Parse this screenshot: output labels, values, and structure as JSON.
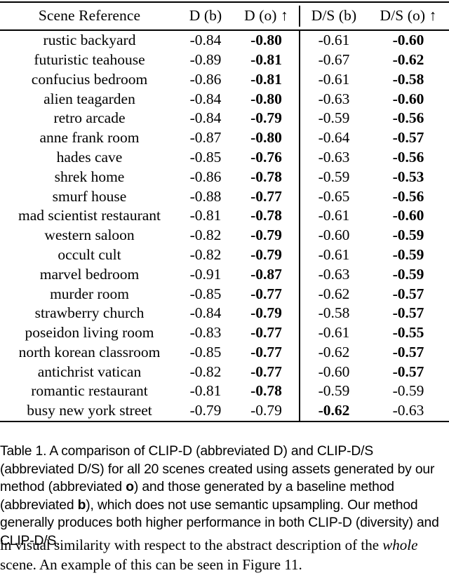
{
  "table": {
    "columns": [
      {
        "key": "scene",
        "label": "Scene Reference"
      },
      {
        "key": "d_b",
        "label": "D (b)"
      },
      {
        "key": "d_o",
        "label": "D (o) ↑"
      },
      {
        "key": "ds_b",
        "label": "D/S (b)"
      },
      {
        "key": "ds_o",
        "label": "D/S (o) ↑"
      }
    ],
    "rows": [
      {
        "scene": "rustic backyard",
        "d_b": "-0.84",
        "d_o": "-0.80",
        "ds_b": "-0.61",
        "ds_o": "-0.60",
        "bold": [
          "d_o",
          "ds_o"
        ]
      },
      {
        "scene": "futuristic teahouse",
        "d_b": "-0.89",
        "d_o": "-0.81",
        "ds_b": "-0.67",
        "ds_o": "-0.62",
        "bold": [
          "d_o",
          "ds_o"
        ]
      },
      {
        "scene": "confucius bedroom",
        "d_b": "-0.86",
        "d_o": "-0.81",
        "ds_b": "-0.61",
        "ds_o": "-0.58",
        "bold": [
          "d_o",
          "ds_o"
        ]
      },
      {
        "scene": "alien teagarden",
        "d_b": "-0.84",
        "d_o": "-0.80",
        "ds_b": "-0.63",
        "ds_o": "-0.60",
        "bold": [
          "d_o",
          "ds_o"
        ]
      },
      {
        "scene": "retro arcade",
        "d_b": "-0.84",
        "d_o": "-0.79",
        "ds_b": "-0.59",
        "ds_o": "-0.56",
        "bold": [
          "d_o",
          "ds_o"
        ]
      },
      {
        "scene": "anne frank room",
        "d_b": "-0.87",
        "d_o": "-0.80",
        "ds_b": "-0.64",
        "ds_o": "-0.57",
        "bold": [
          "d_o",
          "ds_o"
        ]
      },
      {
        "scene": "hades cave",
        "d_b": "-0.85",
        "d_o": "-0.76",
        "ds_b": "-0.63",
        "ds_o": "-0.56",
        "bold": [
          "d_o",
          "ds_o"
        ]
      },
      {
        "scene": "shrek home",
        "d_b": "-0.86",
        "d_o": "-0.78",
        "ds_b": "-0.59",
        "ds_o": "-0.53",
        "bold": [
          "d_o",
          "ds_o"
        ]
      },
      {
        "scene": "smurf house",
        "d_b": "-0.88",
        "d_o": "-0.77",
        "ds_b": "-0.65",
        "ds_o": "-0.56",
        "bold": [
          "d_o",
          "ds_o"
        ]
      },
      {
        "scene": "mad scientist restaurant",
        "d_b": "-0.81",
        "d_o": "-0.78",
        "ds_b": "-0.61",
        "ds_o": "-0.60",
        "bold": [
          "d_o",
          "ds_o"
        ]
      },
      {
        "scene": "western saloon",
        "d_b": "-0.82",
        "d_o": "-0.79",
        "ds_b": "-0.60",
        "ds_o": "-0.59",
        "bold": [
          "d_o",
          "ds_o"
        ]
      },
      {
        "scene": "occult cult",
        "d_b": "-0.82",
        "d_o": "-0.79",
        "ds_b": "-0.61",
        "ds_o": "-0.59",
        "bold": [
          "d_o",
          "ds_o"
        ]
      },
      {
        "scene": "marvel bedroom",
        "d_b": "-0.91",
        "d_o": "-0.87",
        "ds_b": "-0.63",
        "ds_o": "-0.59",
        "bold": [
          "d_o",
          "ds_o"
        ]
      },
      {
        "scene": "murder room",
        "d_b": "-0.85",
        "d_o": "-0.77",
        "ds_b": "-0.62",
        "ds_o": "-0.57",
        "bold": [
          "d_o",
          "ds_o"
        ]
      },
      {
        "scene": "strawberry church",
        "d_b": "-0.84",
        "d_o": "-0.79",
        "ds_b": "-0.58",
        "ds_o": "-0.57",
        "bold": [
          "d_o",
          "ds_o"
        ]
      },
      {
        "scene": "poseidon living room",
        "d_b": "-0.83",
        "d_o": "-0.77",
        "ds_b": "-0.61",
        "ds_o": "-0.55",
        "bold": [
          "d_o",
          "ds_o"
        ]
      },
      {
        "scene": "north korean classroom",
        "d_b": "-0.85",
        "d_o": "-0.77",
        "ds_b": "-0.62",
        "ds_o": "-0.57",
        "bold": [
          "d_o",
          "ds_o"
        ]
      },
      {
        "scene": "antichrist vatican",
        "d_b": "-0.82",
        "d_o": "-0.77",
        "ds_b": "-0.60",
        "ds_o": "-0.57",
        "bold": [
          "d_o",
          "ds_o"
        ]
      },
      {
        "scene": "romantic restaurant",
        "d_b": "-0.81",
        "d_o": "-0.78",
        "ds_b": "-0.59",
        "ds_o": "-0.59",
        "bold": [
          "d_o"
        ]
      },
      {
        "scene": "busy new york street",
        "d_b": "-0.79",
        "d_o": "-0.79",
        "ds_b": "-0.62",
        "ds_o": "-0.63",
        "bold": [
          "ds_b"
        ]
      }
    ]
  },
  "caption": {
    "number": "Table 1.",
    "part1": "A comparison of CLIP-D (abbreviated D) and CLIP-D/S (abbreviated D/S) for all 20 scenes created using assets generated by our method (abbreviated ",
    "bold1": "o",
    "part2": ") and those generated by a baseline method (abbreviated ",
    "bold2": "b",
    "part3": "), which does not use semantic upsampling. Our method generally produces both higher performance in both CLIP-D (diversity) and CLIP-D/S."
  },
  "body_text": {
    "part1": "in visual similarity with respect to the abstract description of the ",
    "italic": "whole",
    "part2": " scene. An example of this can be seen in Figure 11."
  }
}
